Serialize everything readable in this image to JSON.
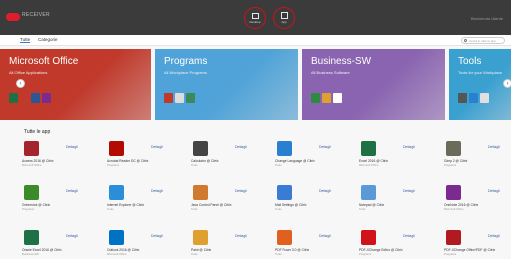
{
  "topbar": {
    "logo_text": "RECEIVER",
    "apps_btn_label": "Desktop",
    "desktops_btn_label": "App",
    "user_text": "Benvenuto Utente"
  },
  "tabs": [
    {
      "label": "Tutte",
      "active": true
    },
    {
      "label": "Categorie",
      "active": false
    }
  ],
  "search": {
    "placeholder": "Cerca in tutte le app"
  },
  "banners": [
    {
      "title": "Microsoft Office",
      "subtitle": "All Office Applications",
      "color": "#c0392b",
      "icons": [
        "#1e7145",
        "#c0392b",
        "#2b5797",
        "#7b2b8f"
      ]
    },
    {
      "title": "Programs",
      "subtitle": "All Workplace Programs",
      "color": "#4fa3d8",
      "icons": [
        "#c0392b",
        "#dcdcdc",
        "#3b8b5a"
      ]
    },
    {
      "title": "Business-SW",
      "subtitle": "All Business Software",
      "color": "#8a64b0",
      "icons": [
        "#2d8a3e",
        "#e0a030",
        "#ffffff"
      ]
    },
    {
      "title": "Tools",
      "subtitle": "Tools for your Workplace",
      "color": "#3aa0d0",
      "icons": [
        "#555555",
        "#2a7fd0",
        "#e0e0e0"
      ]
    }
  ],
  "section_title": "Tutte le app",
  "apps": [
    {
      "name": "Access 2016 @ Citrix",
      "cat": "Microsoft Office",
      "color": "#a4262c"
    },
    {
      "name": "Acrobat Reader DC @ Citrix",
      "cat": "Programs",
      "color": "#b30b00"
    },
    {
      "name": "Calculator @ Citrix",
      "cat": "Tools",
      "color": "#444444"
    },
    {
      "name": "Change Language @ Citrix",
      "cat": "Tools",
      "color": "#2a7fd0"
    },
    {
      "name": "Excel 2016 @ Citrix",
      "cat": "Microsoft Office",
      "color": "#1e7145"
    },
    {
      "name": "Gimp 2 @ Citrix",
      "cat": "Programs",
      "color": "#6b6b5a"
    },
    {
      "name": "Greenshot @ Citrix",
      "cat": "Programs",
      "color": "#3b8b2a"
    },
    {
      "name": "Internet Explorer @ Citrix",
      "cat": "Tools",
      "color": "#2a8fd8"
    },
    {
      "name": "Java Control Panel @ Citrix",
      "cat": "Tools",
      "color": "#d07a30"
    },
    {
      "name": "Mail Settings @ Citrix",
      "cat": "Tools",
      "color": "#3a7bd5"
    },
    {
      "name": "Notepad @ Citrix",
      "cat": "Tools",
      "color": "#5a9ad8"
    },
    {
      "name": "OneNote 2016 @ Citrix",
      "cat": "Microsoft Office",
      "color": "#7b2b8f"
    },
    {
      "name": "Oracle Excel 2016 @ Citrix",
      "cat": "Business-SW",
      "color": "#1e7145"
    },
    {
      "name": "Outlook 2016 @ Citrix",
      "cat": "Microsoft Office",
      "color": "#0072c6"
    },
    {
      "name": "Paint @ Citrix",
      "cat": "Tools",
      "color": "#e0a030"
    },
    {
      "name": "PDF Fuser 3.0 @ Citrix",
      "cat": "Tools",
      "color": "#e06020"
    },
    {
      "name": "PDF-XChange Editor @ Citrix",
      "cat": "Programs",
      "color": "#d0121b"
    },
    {
      "name": "PDF-XChange Office/PDF @ Citrix",
      "cat": "Programs",
      "color": "#b01a20"
    }
  ],
  "detail_label": "Dettagli"
}
